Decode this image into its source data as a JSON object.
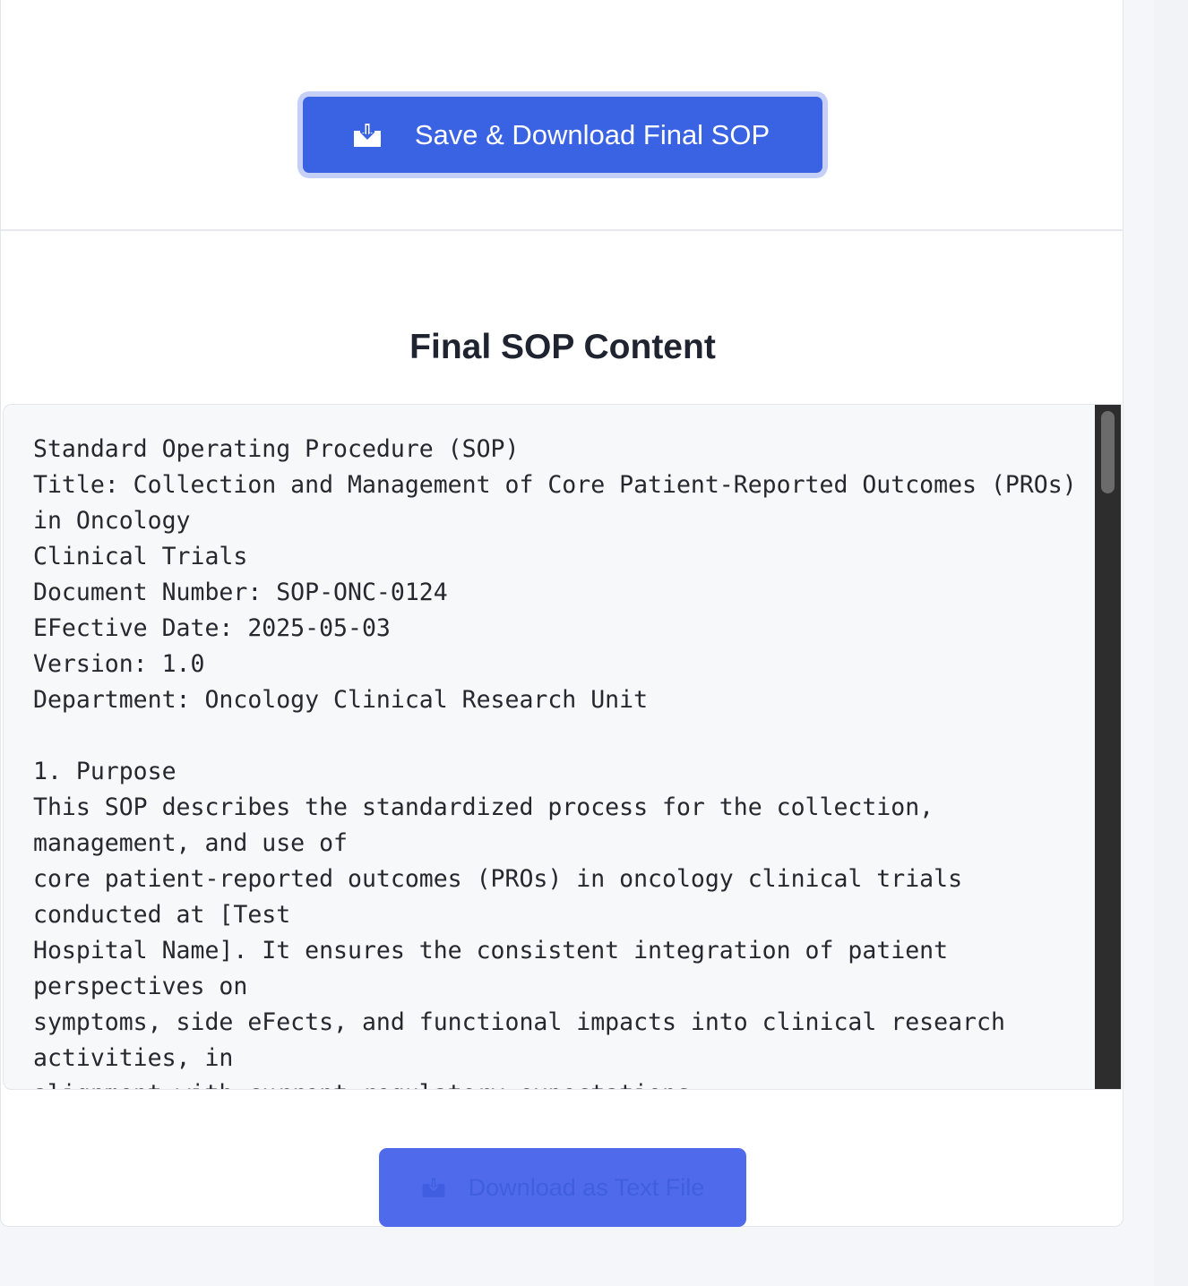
{
  "save_button": {
    "label": "Save & Download Final SOP",
    "icon": "download-icon"
  },
  "final_section": {
    "title": "Final SOP Content",
    "content": "Standard Operating Procedure (SOP)\nTitle: Collection and Management of Core Patient-Reported Outcomes (PROs) in Oncology\nClinical Trials\nDocument Number: SOP-ONC-0124\nEFective Date: 2025-05-03\nVersion: 1.0\nDepartment: Oncology Clinical Research Unit\n\n1. Purpose\nThis SOP describes the standardized process for the collection, management, and use of\ncore patient-reported outcomes (PROs) in oncology clinical trials conducted at [Test\nHospital Name]. It ensures the consistent integration of patient perspectives on\nsymptoms, side eFects, and functional impacts into clinical research activities, in\nalignment with current regulatory expectations"
  },
  "download_text_button": {
    "label": "Download as Text File",
    "icon": "download-icon"
  },
  "colors": {
    "primary_button": "#3a63e4",
    "secondary_button": "#4f6bec",
    "page_background": "#f4f6fa",
    "content_background": "#f7f8fa"
  }
}
